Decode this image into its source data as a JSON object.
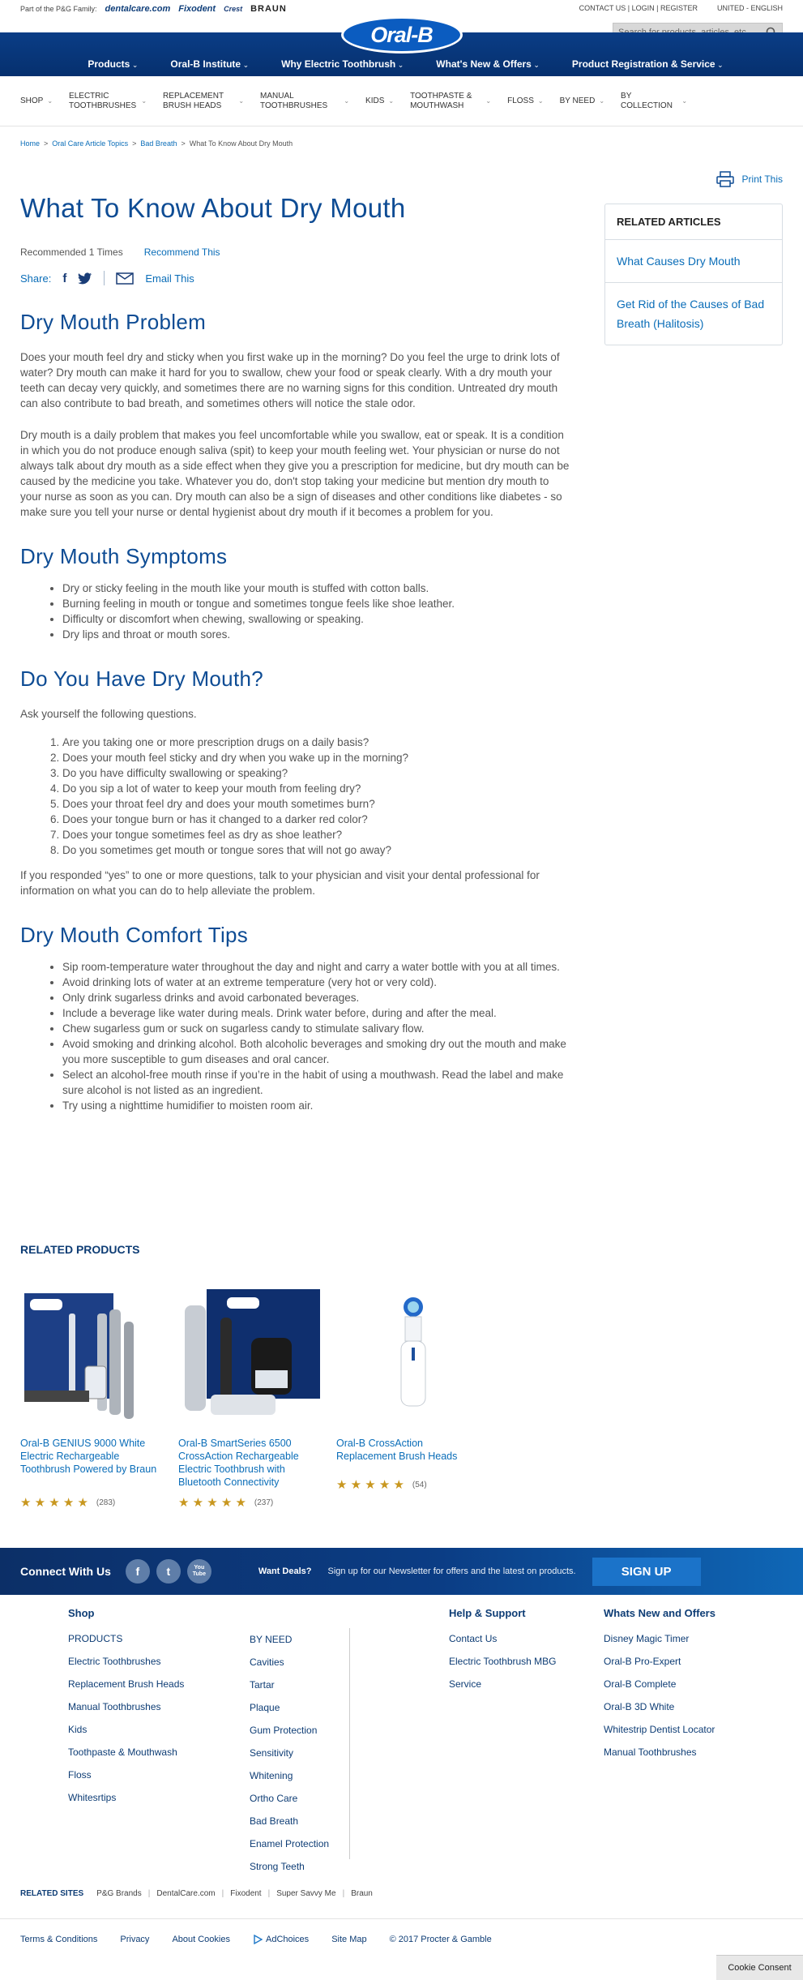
{
  "topbar": {
    "family_label": "Part of the P&G Family:",
    "brands": [
      "dentalcare.com",
      "Fixodent",
      "Crest",
      "BRAUN"
    ],
    "links": [
      "CONTACT US | LOGIN | REGISTER",
      "UNITED - ENGLISH"
    ]
  },
  "search": {
    "placeholder": "Search for products, articles, etc."
  },
  "logo": "Oral-B",
  "nav": [
    "Products",
    "Oral-B Institute",
    "Why Electric Toothbrush",
    "What's New & Offers",
    "Product Registration & Service"
  ],
  "categories": [
    "SHOP",
    "ELECTRIC TOOTHBRUSHES",
    "REPLACEMENT BRUSH HEADS",
    "MANUAL TOOTHBRUSHES",
    "KIDS",
    "TOOTHPASTE & MOUTHWASH",
    "FLOSS",
    "BY NEED",
    "BY COLLECTION"
  ],
  "breadcrumbs": [
    "Home",
    "Oral Care Article Topics",
    "Bad Breath",
    "What To Know About Dry Mouth"
  ],
  "print_label": "Print This",
  "article": {
    "title": "What To Know About Dry Mouth",
    "recommended": "Recommended 1 Times",
    "recommend_link": "Recommend This",
    "share_label": "Share:",
    "email_label": "Email This",
    "sections": {
      "problem": {
        "heading": "Dry Mouth Problem",
        "p1": "Does your mouth feel dry and sticky when you first wake up in the morning? Do you feel the urge to drink lots of water? Dry mouth can make it hard for you to swallow, chew your food or speak clearly. With a dry mouth your teeth can decay very quickly, and sometimes there are no warning signs for this condition. Untreated dry mouth can also contribute to bad breath, and sometimes others will notice the stale odor.",
        "p2": "Dry mouth is a daily problem that makes you feel uncomfortable while you swallow, eat or speak. It is a condition in which you do not produce enough saliva (spit) to keep your mouth feeling wet. Your physician or nurse do not always talk about dry mouth as a side effect when they give you a prescription for medicine, but dry mouth can be caused by the medicine you take. Whatever you do, don't stop taking your medicine but mention dry mouth to your nurse as soon as you can. Dry mouth can also be a sign of diseases and other conditions like diabetes - so make sure you tell your nurse or dental hygienist about dry mouth if it becomes a problem for you."
      },
      "symptoms": {
        "heading": "Dry Mouth Symptoms",
        "items": [
          "Dry or sticky feeling in the mouth like your mouth is stuffed with cotton balls.",
          "Burning feeling in mouth or tongue and sometimes tongue feels like shoe leather.",
          "Difficulty or discomfort when chewing, swallowing or speaking.",
          "Dry lips and throat or mouth sores."
        ]
      },
      "question": {
        "heading": "Do You Have Dry Mouth?",
        "intro": "Ask yourself the following questions.",
        "items": [
          "Are you taking one or more prescription drugs on a daily basis?",
          "Does your mouth feel sticky and dry when you wake up in the morning?",
          "Do you have difficulty swallowing or speaking?",
          "Do you sip a lot of water to keep your mouth from feeling dry?",
          "Does your throat feel dry and does your mouth sometimes burn?",
          "Does your tongue burn or has it changed to a darker red color?",
          "Does your tongue sometimes feel as dry as shoe leather?",
          "Do you sometimes get mouth or tongue sores that will not go away?"
        ],
        "outro": "If you responded “yes” to one or more questions, talk to your physician and visit your dental professional for information on what you can do to help alleviate the problem."
      },
      "tips": {
        "heading": "Dry Mouth Comfort Tips",
        "items": [
          "Sip room-temperature water throughout the day and night and carry a water bottle with you at all times.",
          "Avoid drinking lots of water at an extreme temperature (very hot or very cold).",
          "Only drink sugarless drinks and avoid carbonated beverages.",
          "Include a beverage like water during meals. Drink water before, during and after the meal.",
          "Chew sugarless gum or suck on sugarless candy to stimulate salivary flow.",
          "Avoid smoking and drinking alcohol. Both alcoholic beverages and smoking dry out the mouth and make you more susceptible to gum diseases and oral cancer.",
          "Select an alcohol-free mouth rinse if you’re in the habit of using a mouthwash. Read the label and make sure alcohol is not listed as an ingredient.",
          "Try using a nighttime humidifier to moisten room air."
        ]
      }
    }
  },
  "related_articles": {
    "title": "RELATED ARTICLES",
    "items": [
      "What Causes Dry Mouth",
      "Get Rid of the Causes of Bad Breath (Halitosis)"
    ]
  },
  "related_products": {
    "title": "RELATED PRODUCTS",
    "items": [
      {
        "name": "Oral-B GENIUS 9000 White Electric Rechargeable Toothbrush Powered by Braun",
        "reviews": "(283)",
        "rating": 5
      },
      {
        "name": "Oral-B SmartSeries 6500 CrossAction Rechargeable Electric Toothbrush with Bluetooth Connectivity",
        "reviews": "(237)",
        "rating": 5
      },
      {
        "name": "Oral-B CrossAction Replacement Brush Heads",
        "reviews": "(54)",
        "rating": 5
      }
    ]
  },
  "connect": {
    "title": "Connect With Us",
    "social": [
      "f",
      "t",
      "You Tube"
    ],
    "deals": "Want Deals?",
    "deals_text": "Sign up for our Newsletter for offers and the latest on products.",
    "signup": "SIGN UP"
  },
  "footer": {
    "shop_title": "Shop",
    "shop_col1": [
      "PRODUCTS",
      "Electric Toothbrushes",
      "Replacement Brush Heads",
      "Manual Toothbrushes",
      "Kids",
      "Toothpaste & Mouthwash",
      "Floss",
      "Whitesrtips"
    ],
    "shop_col2": [
      "BY NEED",
      "Cavities",
      "Tartar",
      "Plaque",
      "Gum Protection",
      "Sensitivity",
      "Whitening",
      "Ortho Care",
      "Bad Breath",
      "Enamel Protection",
      "Strong Teeth"
    ],
    "help_title": "Help & Support",
    "help_items": [
      "Contact Us",
      "Electric Toothbrush MBG",
      "Service"
    ],
    "whats_title": "Whats New and Offers",
    "whats_items": [
      "Disney Magic Timer",
      "Oral-B Pro-Expert",
      "Oral-B Complete",
      "Oral-B 3D White",
      "Whitestrip Dentist Locator",
      "Manual Toothbrushes"
    ]
  },
  "related_sites": {
    "label": "RELATED SITES",
    "items": [
      "P&G Brands",
      "DentalCare.com",
      "Fixodent",
      "Super Savvy Me",
      "Braun"
    ]
  },
  "legal": [
    "Terms & Conditions",
    "Privacy",
    "About Cookies",
    "AdChoices",
    "Site Map",
    "© 2017 Procter & Gamble"
  ],
  "cookie": "Cookie Consent"
}
